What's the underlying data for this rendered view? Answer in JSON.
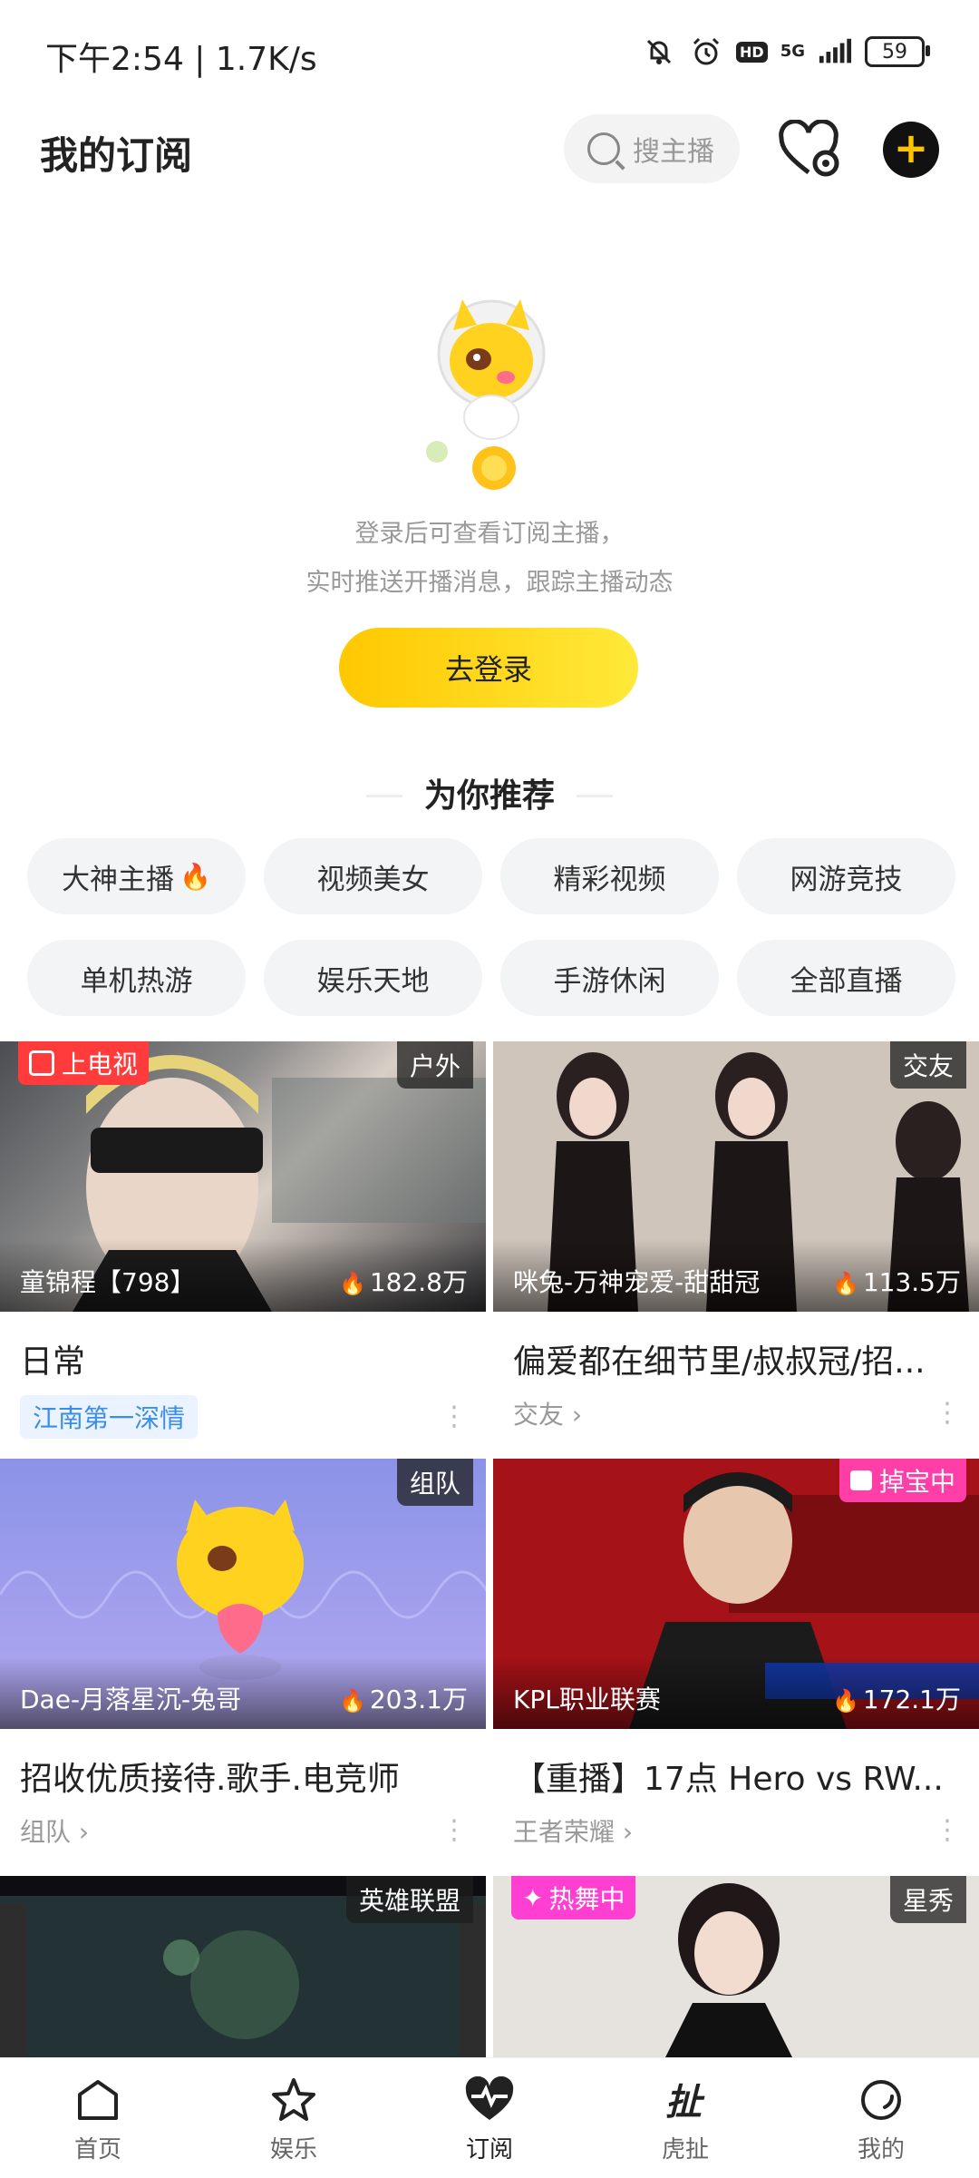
{
  "status": {
    "time": "下午2:54 | 1.7K/s",
    "network": "5G",
    "hd": "HD",
    "battery": "59"
  },
  "header": {
    "title": "我的订阅",
    "search_placeholder": "搜主播"
  },
  "empty": {
    "line1": "登录后可查看订阅主播，",
    "line2": "实时推送开播消息，跟踪主播动态",
    "login_label": "去登录"
  },
  "recommend": {
    "title": "为你推荐",
    "chips": [
      "大神主播",
      "视频美女",
      "精彩视频",
      "网游竞技",
      "单机热游",
      "娱乐天地",
      "手游休闲",
      "全部直播"
    ]
  },
  "cards": [
    {
      "corner_tag": "户外",
      "left_tag": "上电视",
      "streamer": "童锦程【798】",
      "viewers": "182.8万",
      "title": "日常",
      "badge": "江南第一深情",
      "category": ""
    },
    {
      "corner_tag": "交友",
      "left_tag": "",
      "streamer": "咪兔-万神宠爱-甜甜冠",
      "viewers": "113.5万",
      "title": "偏爱都在细节里/叔叔冠/招...",
      "badge": "",
      "category": "交友"
    },
    {
      "corner_tag": "组队",
      "left_tag": "",
      "streamer": "Dae-月落星沉-兔哥",
      "viewers": "203.1万",
      "title": "招收优质接待.歌手.电竞师",
      "badge": "",
      "category": "组队"
    },
    {
      "corner_tag": "",
      "left_tag": "掉宝中",
      "streamer": "KPL职业联赛",
      "viewers": "172.1万",
      "title": "【重播】17点 Hero vs RW...",
      "badge": "",
      "category": "王者荣耀"
    },
    {
      "corner_tag": "英雄联盟",
      "left_tag": "",
      "streamer": "",
      "viewers": "",
      "title": "",
      "badge": "",
      "category": ""
    },
    {
      "corner_tag": "星秀",
      "left_tag": "热舞中",
      "streamer": "",
      "viewers": "",
      "title": "",
      "badge": "",
      "category": ""
    }
  ],
  "tabbar": [
    "首页",
    "娱乐",
    "订阅",
    "虎扯",
    "我的"
  ]
}
